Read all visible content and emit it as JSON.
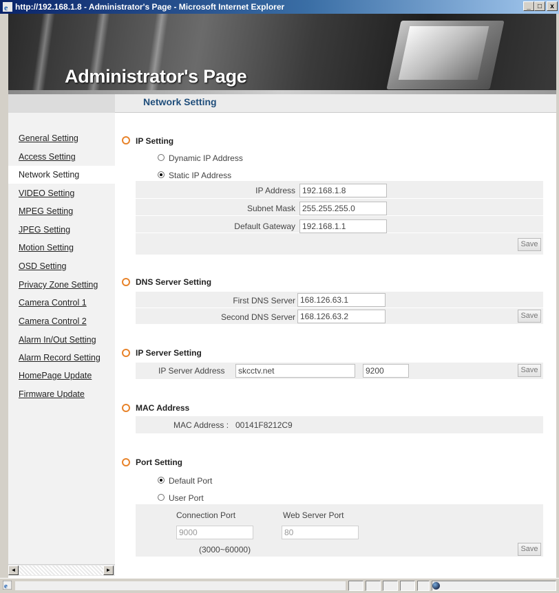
{
  "window": {
    "title": "http://192.168.1.8 - Administrator's Page - Microsoft Internet Explorer",
    "minimize": "_",
    "maximize": "□",
    "close": "x"
  },
  "banner": {
    "heading": "Administrator's Page"
  },
  "page": {
    "title": "Network Setting"
  },
  "sidebar": {
    "items": [
      {
        "label": "General Setting"
      },
      {
        "label": "Access Setting"
      },
      {
        "label": "Network Setting",
        "active": true
      },
      {
        "label": "VIDEO Setting"
      },
      {
        "label": "MPEG Setting"
      },
      {
        "label": "JPEG Setting"
      },
      {
        "label": "Motion Setting"
      },
      {
        "label": "OSD Setting"
      },
      {
        "label": "Privacy Zone Setting"
      },
      {
        "label": "Camera Control 1"
      },
      {
        "label": "Camera Control 2"
      },
      {
        "label": "Alarm In/Out Setting"
      },
      {
        "label": "Alarm Record Setting"
      },
      {
        "label": "HomePage Update"
      },
      {
        "label": "Firmware Update"
      }
    ]
  },
  "ip_setting": {
    "title": "IP Setting",
    "dynamic_label": "Dynamic IP Address",
    "static_label": "Static IP Address",
    "selected": "static",
    "ip_label": "IP Address",
    "ip_value": "192.168.1.8",
    "subnet_label": "Subnet Mask",
    "subnet_value": "255.255.255.0",
    "gateway_label": "Default Gateway",
    "gateway_value": "192.168.1.1",
    "save_label": "Save"
  },
  "dns": {
    "title": "DNS Server Setting",
    "first_label": "First DNS Server",
    "first_value": "168.126.63.1",
    "second_label": "Second DNS Server",
    "second_value": "168.126.63.2",
    "save_label": "Save"
  },
  "ip_server": {
    "title": "IP Server Setting",
    "address_label": "IP Server Address",
    "address_value": "skcctv.net",
    "port_value": "9200",
    "save_label": "Save"
  },
  "mac": {
    "title": "MAC Address",
    "label": "MAC Address :",
    "value": "00141F8212C9"
  },
  "port": {
    "title": "Port Setting",
    "default_label": "Default Port",
    "user_label": "User Port",
    "selected": "default",
    "connection_label": "Connection Port",
    "connection_value": "9000",
    "web_label": "Web Server Port",
    "web_value": "80",
    "range_text": "(3000~60000)",
    "save_label": "Save"
  },
  "scrollbar": {
    "left_arrow": "◄",
    "right_arrow": "►"
  },
  "colors": {
    "section_icon": "#e8832a",
    "page_title": "#1f4d7a",
    "panel_bg": "#efefef"
  }
}
